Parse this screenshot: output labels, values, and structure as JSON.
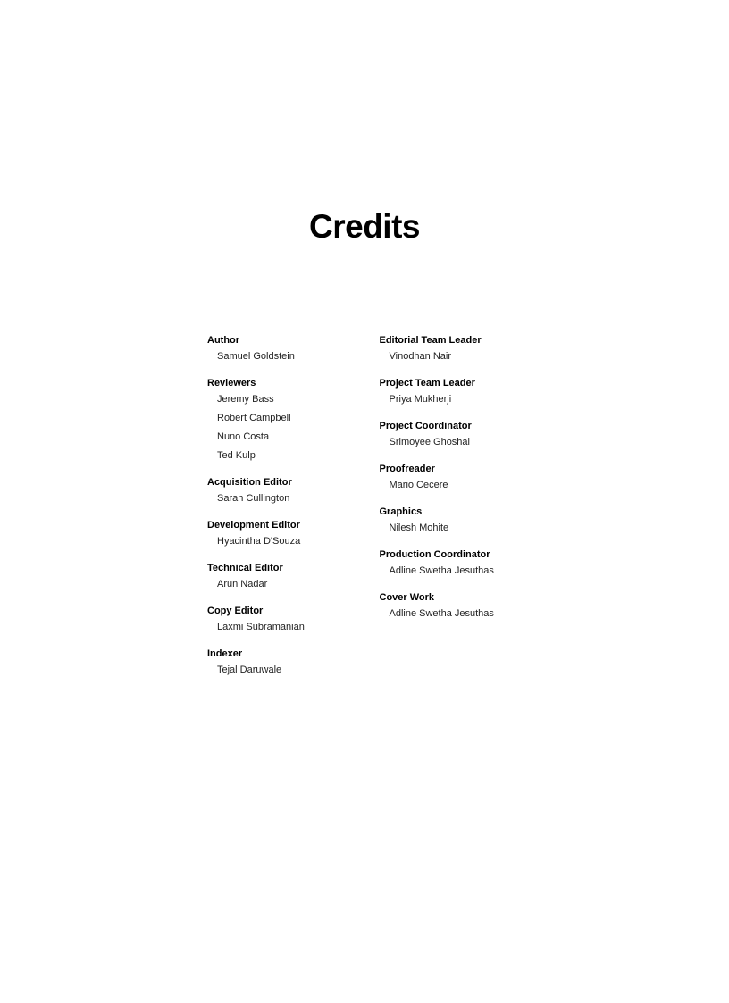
{
  "title": "Credits",
  "left_column": [
    {
      "role": "Author",
      "people": [
        "Samuel Goldstein"
      ]
    },
    {
      "role": "Reviewers",
      "people": [
        "Jeremy Bass",
        "Robert Campbell",
        "Nuno Costa",
        "Ted Kulp"
      ]
    },
    {
      "role": "Acquisition Editor",
      "people": [
        "Sarah Cullington"
      ]
    },
    {
      "role": "Development Editor",
      "people": [
        "Hyacintha D'Souza"
      ]
    },
    {
      "role": "Technical Editor",
      "people": [
        "Arun Nadar"
      ]
    },
    {
      "role": "Copy Editor",
      "people": [
        "Laxmi Subramanian"
      ]
    },
    {
      "role": "Indexer",
      "people": [
        "Tejal Daruwale"
      ]
    }
  ],
  "right_column": [
    {
      "role": "Editorial Team Leader",
      "people": [
        "Vinodhan Nair"
      ]
    },
    {
      "role": "Project Team Leader",
      "people": [
        "Priya Mukherji"
      ]
    },
    {
      "role": "Project Coordinator",
      "people": [
        "Srimoyee Ghoshal"
      ]
    },
    {
      "role": "Proofreader",
      "people": [
        "Mario Cecere"
      ]
    },
    {
      "role": "Graphics",
      "people": [
        "Nilesh Mohite"
      ]
    },
    {
      "role": "Production Coordinator",
      "people": [
        "Adline Swetha Jesuthas"
      ]
    },
    {
      "role": "Cover Work",
      "people": [
        "Adline Swetha Jesuthas"
      ]
    }
  ]
}
